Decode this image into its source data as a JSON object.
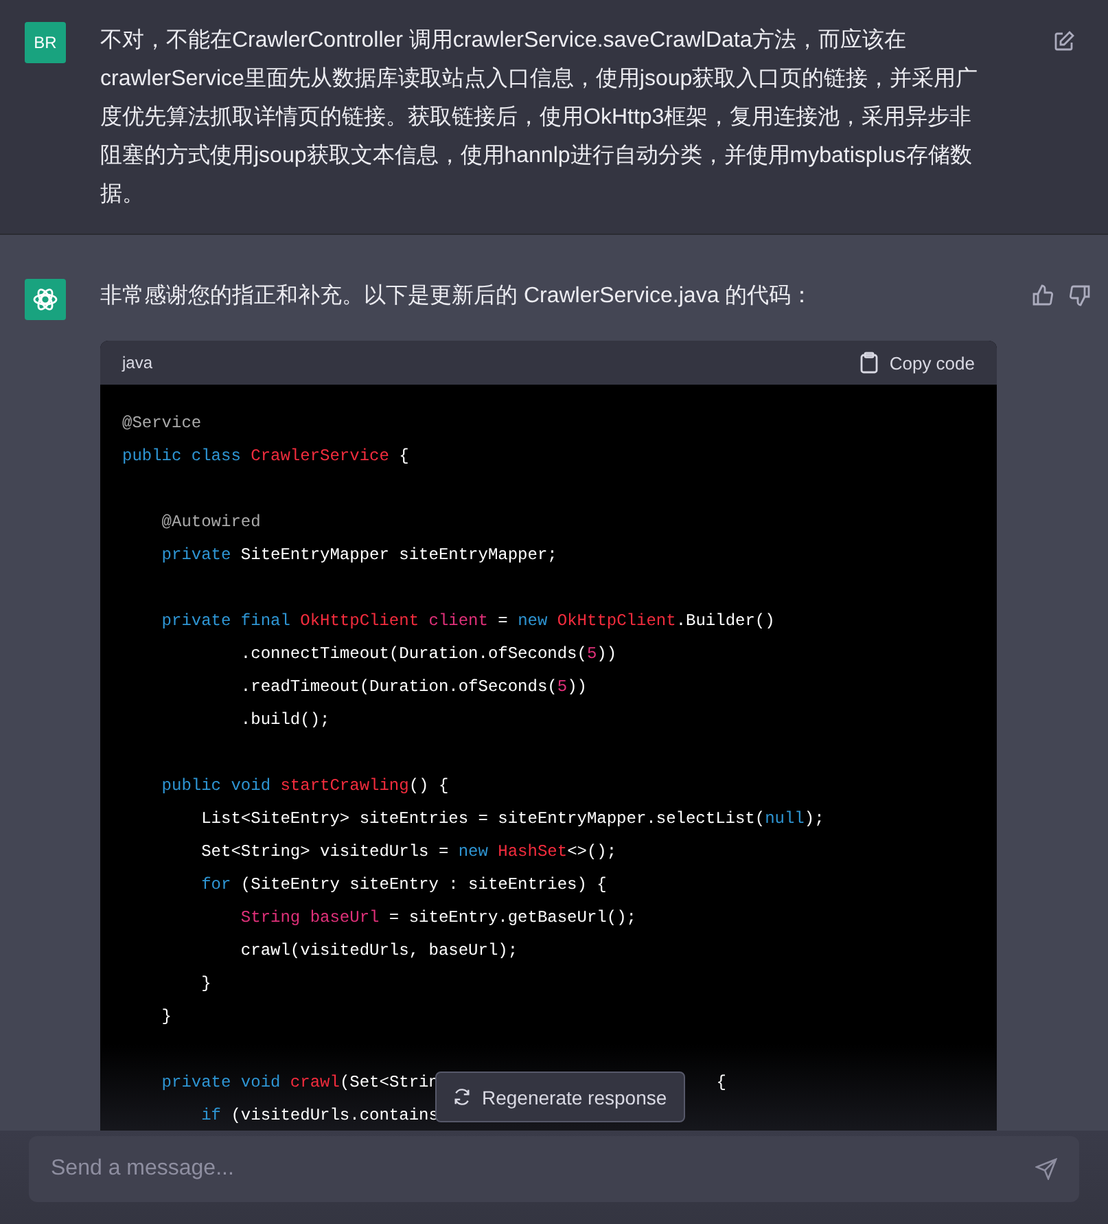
{
  "user_message": {
    "avatar": "BR",
    "text": "不对，不能在CrawlerController 调用crawlerService.saveCrawlData方法，而应该在crawlerService里面先从数据库读取站点入口信息，使用jsoup获取入口页的链接，并采用广度优先算法抓取详情页的链接。获取链接后，使用OkHttp3框架，复用连接池，采用异步非阻塞的方式使用jsoup获取文本信息，使用hannlp进行自动分类，并使用mybatisplus存储数据。"
  },
  "assistant_message": {
    "text": "非常感谢您的指正和补充。以下是更新后的 CrawlerService.java 的代码：",
    "code_block": {
      "language": "java",
      "copy_label": "Copy code",
      "lines": [
        {
          "kind": "code",
          "tokens": [
            {
              "kind": "annotation",
              "text": "@Service"
            }
          ]
        },
        {
          "kind": "code",
          "tokens": [
            {
              "kind": "keyword",
              "text": "public class "
            },
            {
              "kind": "type",
              "text": "CrawlerService"
            },
            {
              "kind": "plain",
              "text": " {"
            }
          ]
        },
        {
          "kind": "blank"
        },
        {
          "kind": "code",
          "tokens": [
            {
              "kind": "annotation",
              "text": "    @Autowired"
            }
          ]
        },
        {
          "kind": "code",
          "tokens": [
            {
              "kind": "keyword",
              "text": "    private "
            },
            {
              "kind": "plain",
              "text": "SiteEntryMapper siteEntryMapper;"
            }
          ]
        },
        {
          "kind": "blank"
        },
        {
          "kind": "code",
          "tokens": [
            {
              "kind": "keyword",
              "text": "    private final "
            },
            {
              "kind": "type",
              "text": "OkHttpClient "
            },
            {
              "kind": "variable",
              "text": "client"
            },
            {
              "kind": "plain",
              "text": " = "
            },
            {
              "kind": "keyword",
              "text": "new "
            },
            {
              "kind": "type",
              "text": "OkHttpClient"
            },
            {
              "kind": "plain",
              "text": ".Builder()"
            }
          ]
        },
        {
          "kind": "code",
          "tokens": [
            {
              "kind": "plain",
              "text": "            .connectTimeout(Duration.ofSeconds("
            },
            {
              "kind": "number",
              "text": "5"
            },
            {
              "kind": "plain",
              "text": "))"
            }
          ]
        },
        {
          "kind": "code",
          "tokens": [
            {
              "kind": "plain",
              "text": "            .readTimeout(Duration.ofSeconds("
            },
            {
              "kind": "number",
              "text": "5"
            },
            {
              "kind": "plain",
              "text": "))"
            }
          ]
        },
        {
          "kind": "code",
          "tokens": [
            {
              "kind": "plain",
              "text": "            .build();"
            }
          ]
        },
        {
          "kind": "blank"
        },
        {
          "kind": "code",
          "tokens": [
            {
              "kind": "keyword",
              "text": "    public void "
            },
            {
              "kind": "type",
              "text": "startCrawling"
            },
            {
              "kind": "plain",
              "text": "() {"
            }
          ]
        },
        {
          "kind": "code",
          "tokens": [
            {
              "kind": "plain",
              "text": "        List<SiteEntry> siteEntries = siteEntryMapper.selectList("
            },
            {
              "kind": "keyword",
              "text": "null"
            },
            {
              "kind": "plain",
              "text": ");"
            }
          ]
        },
        {
          "kind": "code",
          "tokens": [
            {
              "kind": "plain",
              "text": "        Set<String> visitedUrls = "
            },
            {
              "kind": "keyword",
              "text": "new "
            },
            {
              "kind": "type",
              "text": "HashSet"
            },
            {
              "kind": "plain",
              "text": "<>();"
            }
          ]
        },
        {
          "kind": "code",
          "tokens": [
            {
              "kind": "keyword",
              "text": "        for"
            },
            {
              "kind": "plain",
              "text": " (SiteEntry siteEntry : siteEntries) {"
            }
          ]
        },
        {
          "kind": "code",
          "tokens": [
            {
              "kind": "variable",
              "text": "            String baseUrl"
            },
            {
              "kind": "plain",
              "text": " = siteEntry.getBaseUrl();"
            }
          ]
        },
        {
          "kind": "code",
          "tokens": [
            {
              "kind": "plain",
              "text": "            crawl(visitedUrls, baseUrl);"
            }
          ]
        },
        {
          "kind": "code",
          "tokens": [
            {
              "kind": "plain",
              "text": "        }"
            }
          ]
        },
        {
          "kind": "code",
          "tokens": [
            {
              "kind": "plain",
              "text": "    }"
            }
          ]
        },
        {
          "kind": "blank"
        },
        {
          "kind": "split",
          "tokens": [
            {
              "kind": "keyword",
              "text": "    private void "
            },
            {
              "kind": "type",
              "text": "crawl"
            },
            {
              "kind": "plain",
              "text": "(Set<Strin"
            }
          ],
          "tail_tokens": [
            {
              "kind": "plain",
              "text": "{"
            }
          ]
        },
        {
          "kind": "code",
          "tokens": [
            {
              "kind": "keyword",
              "text": "        if"
            },
            {
              "kind": "plain",
              "text": " (visitedUrls.contains"
            }
          ]
        }
      ]
    }
  },
  "regenerate_button": {
    "label": "Regenerate response"
  },
  "composer": {
    "placeholder": "Send a message..."
  }
}
